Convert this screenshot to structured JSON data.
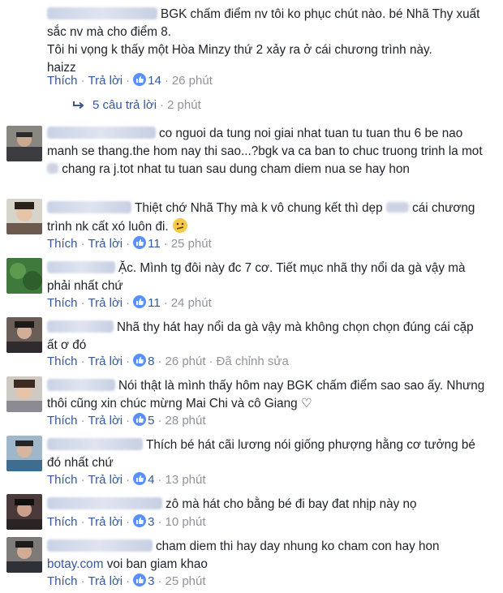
{
  "actions": {
    "like": "Thích",
    "reply": "Trả lời",
    "separator": "·",
    "edited": "Đã chỉnh sửa"
  },
  "colors": {
    "link": "#365899",
    "meta": "#90949c",
    "text": "#1d2129",
    "like_badge": "#5890ff"
  },
  "comments": [
    {
      "lines": [
        "BGK chấm điểm nv tôi ko phục chút nào. bé Nhã Thy xuất",
        "sắc nv mà cho điểm 8.",
        "Tôi hi vọng k thấy một Hòa Minzy thứ 2 xảy ra ở cái chương trình này.",
        "haizz"
      ],
      "likes": "14",
      "time": "26 phút",
      "replies": {
        "label": "5 câu trả lời",
        "time": "2 phút"
      }
    },
    {
      "lines": [
        "co nguoi da tung noi giai nhat tuan tu tuan thu 6 be nao",
        "manh se thang.the hom nay thi sao...?bgk va ca ban to chuc truong trinh la mot",
        "chang ra j.tot nhat tu tuan sau dung cham diem nua se hay hon"
      ],
      "likes": "",
      "time": ""
    },
    {
      "lines": [
        "Thiệt chớ Nhã Thy mà k vô chung kết thì dẹp",
        "cái chương",
        "trình nk cất xó luôn đi."
      ],
      "emoji": "confused-face",
      "likes": "11",
      "time": "25 phút"
    },
    {
      "lines": [
        "Ặc. Mình tg đôi này đc 7 cơ. Tiết mục nhã thy nổi da gà vậy mà",
        "phải nhất chứ"
      ],
      "likes": "11",
      "time": "24 phút"
    },
    {
      "lines": [
        "Nhã thy hát hay nổi da gà vậy mà không chọn chọn đúng cái cặp",
        "ất ơ đó"
      ],
      "likes": "8",
      "time": "26 phút",
      "edited": true
    },
    {
      "lines": [
        "Nói thật là mình thấy hôm nay BGK chấm điểm sao sao ấy. Nhưng",
        "thôi cũng xin chúc mừng Mai Chi và cô Giang ♡"
      ],
      "likes": "5",
      "time": "28 phút"
    },
    {
      "lines": [
        "Thích bé hát cãi lương nói giống phượng hằng cơ tưởng bé",
        "đó nhất chứ"
      ],
      "likes": "4",
      "time": "13 phút"
    },
    {
      "lines": [
        "zô mà hát cho bằng bé đi bay đat nhịp này nọ"
      ],
      "likes": "3",
      "time": "10 phút"
    },
    {
      "lines": [
        "cham diem thi hay day nhung ko cham con hay hon",
        "voi ban giam khao"
      ],
      "link": "botay.com",
      "likes": "3",
      "time": "25 phút"
    }
  ]
}
